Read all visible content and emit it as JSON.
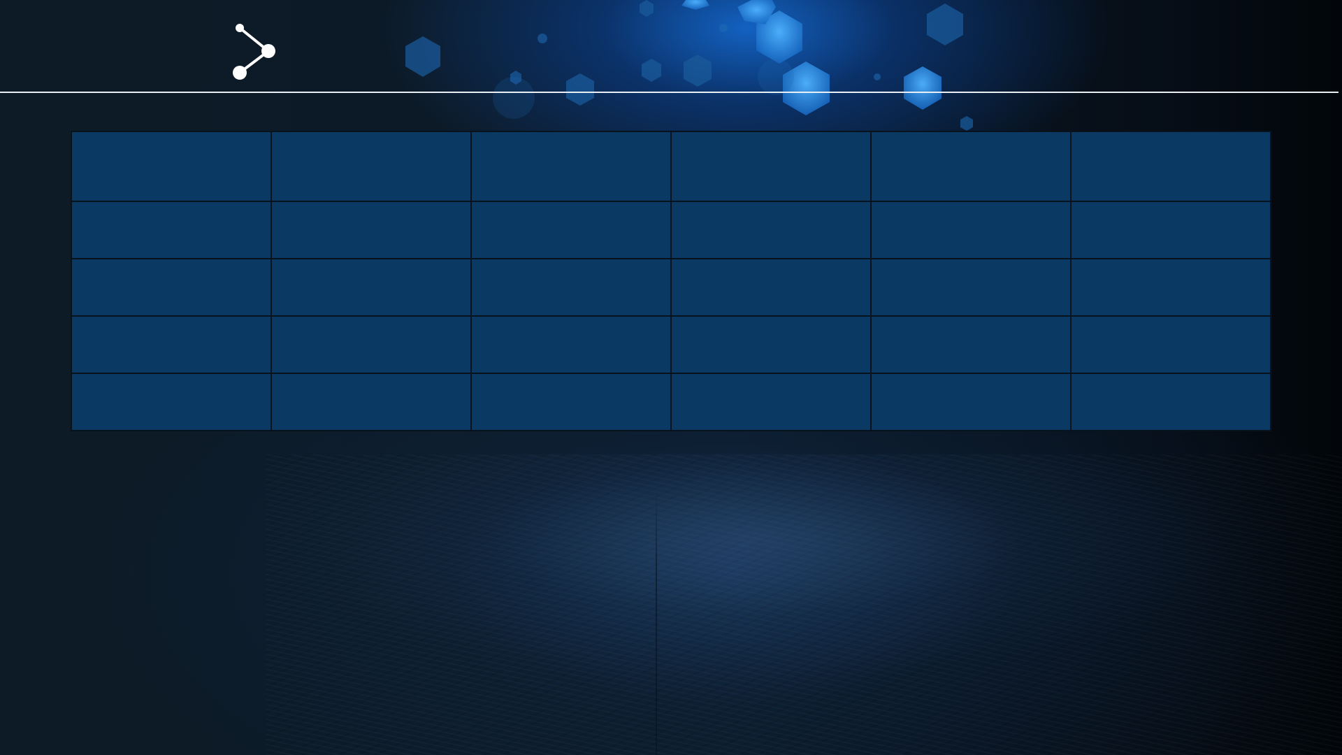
{
  "header": {
    "icon": "share-icon",
    "title": ""
  },
  "colors": {
    "table_cell": "#0a3a63",
    "table_border": "#08121d",
    "rule": "#e9eef3",
    "background": "#0c1824",
    "hexagon": "#1e8ad8"
  },
  "table": {
    "columns": [
      "",
      "",
      "",
      "",
      "",
      ""
    ],
    "rows": [
      [
        "",
        "",
        "",
        "",
        "",
        ""
      ],
      [
        "",
        "",
        "",
        "",
        "",
        ""
      ],
      [
        "",
        "",
        "",
        "",
        "",
        ""
      ],
      [
        "",
        "",
        "",
        "",
        "",
        ""
      ]
    ]
  }
}
